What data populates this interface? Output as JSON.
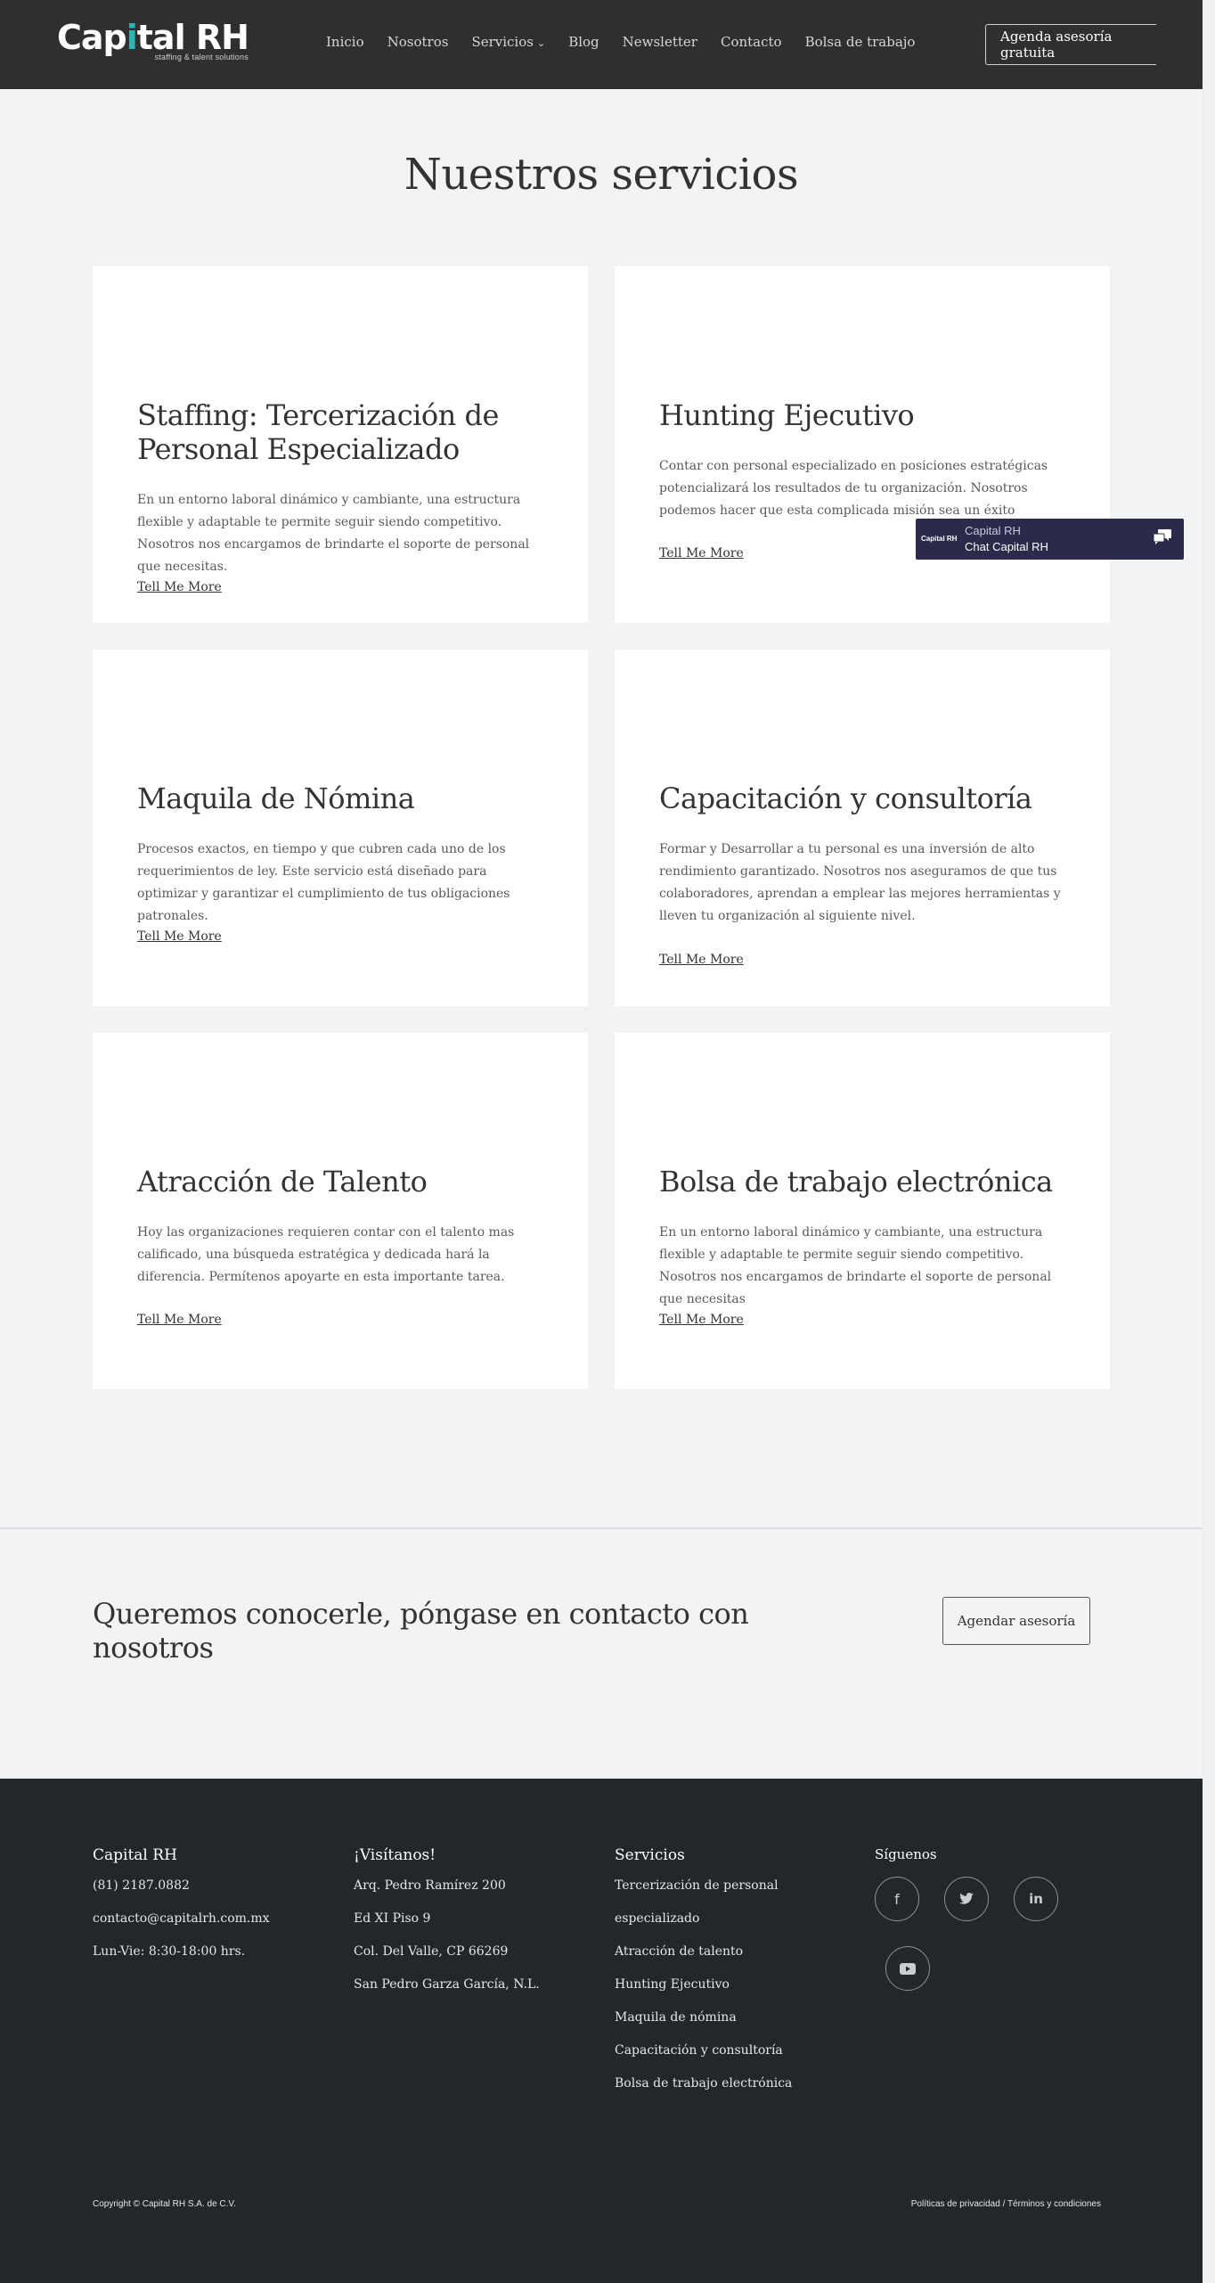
{
  "header": {
    "logo_prefix": "Cap",
    "logo_accent": "i",
    "logo_suffix": "tal RH",
    "logo_tagline": "staffing & talent solutions",
    "nav": [
      "Inicio",
      "Nosotros",
      "Servicios",
      "Blog",
      "Newsletter",
      "Contacto",
      "Bolsa de trabajo"
    ],
    "cta": "Agenda asesoría gratuita"
  },
  "page_title": "Nuestros servicios",
  "services": [
    {
      "title": "Staffing: Tercerización de Personal Especializado",
      "text": "En un entorno laboral dinámico y cambiante, una estructura flexible y adaptable te permite seguir siendo competitivo. Nosotros nos encargamos de brindarte el soporte de personal que necesitas.",
      "link": "Tell Me More"
    },
    {
      "title": "Hunting Ejecutivo",
      "text": "Contar con personal especializado en posiciones estratégicas potencializará los resultados de tu organización. Nosotros podemos hacer que esta complicada misión sea un éxito",
      "link": "Tell Me More"
    },
    {
      "title": "Maquila de Nómina",
      "text": "Procesos exactos, en tiempo y que cubren cada uno de los requerimientos de ley. Este servicio está diseñado para optimizar y garantizar el cumplimiento de tus obligaciones patronales.",
      "link": "Tell Me More"
    },
    {
      "title": "Capacitación y consultoría",
      "text": "Formar y Desarrollar a tu personal es una inversión de alto rendimiento garantizado. Nosotros nos aseguramos de que tus colaboradores, aprendan a emplear las mejores herramientas y lleven tu organización al siguiente nivel.",
      "link": "Tell Me More"
    },
    {
      "title": "Atracción de Talento",
      "text": "Hoy las organizaciones requieren contar con el talento mas calificado, una búsqueda estratégica y dedicada hará la diferencia. Permítenos apoyarte en esta importante tarea.",
      "link": "Tell Me More"
    },
    {
      "title": "Bolsa de trabajo electrónica",
      "text": "En un entorno laboral dinámico y cambiante, una estructura flexible y adaptable te permite seguir siendo competitivo. Nosotros nos encargamos de brindarte el soporte de personal que necesitas",
      "link": "Tell Me More"
    }
  ],
  "chat": {
    "logo": "Capital RH",
    "title": "Capital RH",
    "subtitle": "Chat Capital RH"
  },
  "contact_band": {
    "title": "Queremos conocerle, póngase en contacto con nosotros",
    "button": "Agendar asesoría"
  },
  "footer": {
    "col1": {
      "title": "Capital RH",
      "lines": [
        "(81) 2187.0882",
        "contacto@capitalrh.com.mx",
        "Lun-Vie: 8:30-18:00 hrs."
      ]
    },
    "col2": {
      "title": "¡Visítanos!",
      "lines": [
        "Arq. Pedro Ramírez 200",
        "Ed XI Piso 9",
        "Col. Del Valle, CP 66269",
        "San Pedro Garza García, N.L."
      ]
    },
    "col3": {
      "title": "Servicios",
      "lines": [
        "Tercerización de personal",
        "especializado",
        "Atracción de talento",
        "Hunting Ejecutivo",
        "Maquila de nómina",
        "Capacitación y consultoría",
        "Bolsa de trabajo electrónica"
      ]
    },
    "col4": {
      "title": "Síguenos",
      "social": [
        "facebook-icon",
        "twitter-icon",
        "linkedin-icon",
        "youtube-icon"
      ]
    },
    "copyright": "Copyright © Capital RH S.A. de C.V.",
    "legal": "Políticas de privacidad   / Términos y condiciones"
  }
}
